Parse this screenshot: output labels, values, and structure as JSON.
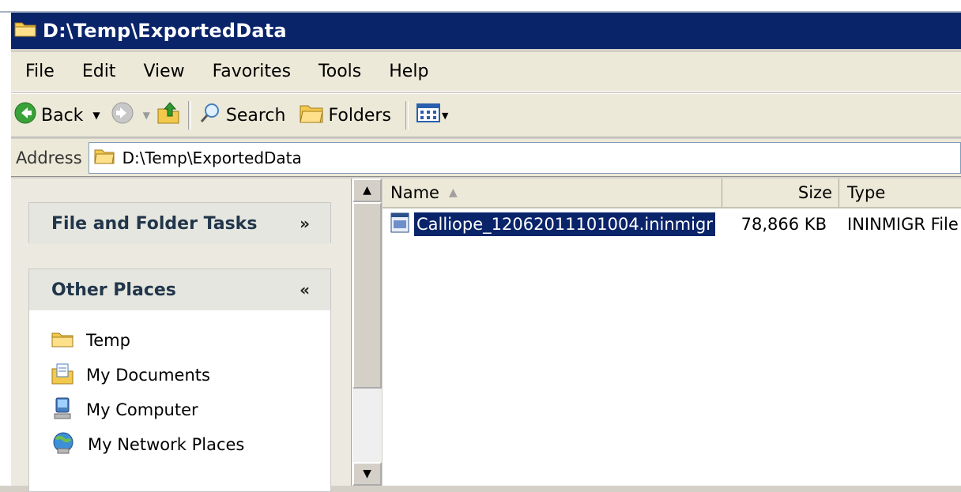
{
  "window": {
    "title": "D:\\Temp\\ExportedData"
  },
  "menu": [
    "File",
    "Edit",
    "View",
    "Favorites",
    "Tools",
    "Help"
  ],
  "toolbar": {
    "back": "Back",
    "search": "Search",
    "folders": "Folders"
  },
  "address": {
    "label": "Address",
    "path": "D:\\Temp\\ExportedData"
  },
  "taskpane": {
    "file_tasks_title": "File and Folder Tasks",
    "other_places_title": "Other Places",
    "places": [
      "Temp",
      "My Documents",
      "My Computer",
      "My Network Places"
    ]
  },
  "columns": {
    "name": "Name",
    "size": "Size",
    "type": "Type"
  },
  "files": [
    {
      "name": "Calliope_12062011101004.ininmigr",
      "size": "78,866 KB",
      "type": "ININMIGR File"
    }
  ],
  "colors": {
    "titlebar": "#0a246a",
    "selection": "#0a246a",
    "chrome": "#ece9d8"
  }
}
